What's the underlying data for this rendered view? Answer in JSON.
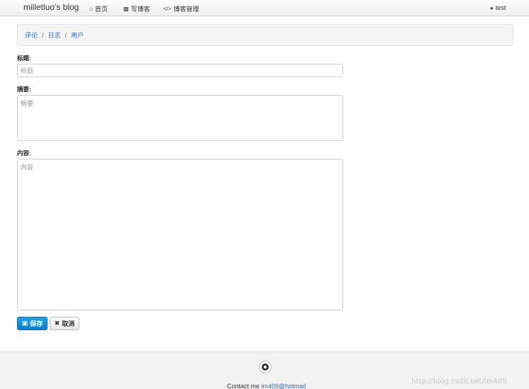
{
  "navbar": {
    "brand": "milletluo's blog",
    "items": [
      {
        "icon": "home-icon",
        "label": "首页"
      },
      {
        "icon": "book-icon",
        "label": "写博客"
      },
      {
        "icon": "code-icon",
        "label": "博客管理"
      }
    ],
    "user": "test"
  },
  "breadcrumb": [
    "评论",
    "日志",
    "用户"
  ],
  "form": {
    "title_label": "标题:",
    "title_placeholder": "标题",
    "summary_label": "摘要:",
    "summary_placeholder": "摘要",
    "content_label": "内容:",
    "content_placeholder": "内容"
  },
  "buttons": {
    "save": "保存",
    "cancel": "取消"
  },
  "footer": {
    "contact_prefix": "Contact me",
    "contact_link": "lm409@hotmail"
  },
  "watermark": "http://blog.csdn.net/lm409",
  "colors": {
    "accent": "#0a7fc8",
    "link": "#2a6db5"
  }
}
